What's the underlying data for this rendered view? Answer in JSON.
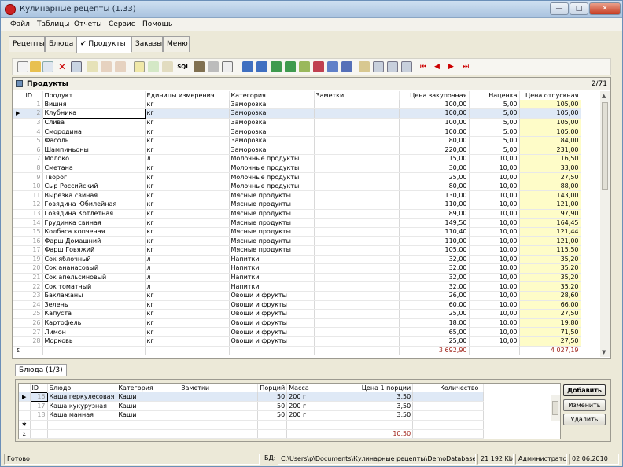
{
  "window": {
    "title": "Кулинарные рецепты (1.33)",
    "min": "—",
    "max": "□",
    "close": "✕"
  },
  "menu": [
    "Файл",
    "Таблицы",
    "Отчеты",
    "Сервис",
    "Помощь"
  ],
  "tabs": [
    {
      "label": "Рецепты"
    },
    {
      "label": "Блюда"
    },
    {
      "label": "✔ Продукты"
    },
    {
      "label": "Заказы"
    },
    {
      "label": "Меню"
    }
  ],
  "toolbar": {
    "sql_label": "SQL"
  },
  "products": {
    "title": "Продукты",
    "count": "2/71",
    "columns": [
      "ID",
      "Продукт",
      "Единицы измерения",
      "Категория",
      "Заметки",
      "Цена закупочная",
      "Наценка",
      "Цена отпускная"
    ],
    "rows": [
      [
        "1",
        "Вишня",
        "кг",
        "Заморозка",
        "",
        "100,00",
        "5,00",
        "105,00"
      ],
      [
        "2",
        "Клубника",
        "кг",
        "Заморозка",
        "",
        "100,00",
        "5,00",
        "105,00"
      ],
      [
        "3",
        "Слива",
        "кг",
        "Заморозка",
        "",
        "100,00",
        "5,00",
        "105,00"
      ],
      [
        "4",
        "Смородина",
        "кг",
        "Заморозка",
        "",
        "100,00",
        "5,00",
        "105,00"
      ],
      [
        "5",
        "Фасоль",
        "кг",
        "Заморозка",
        "",
        "80,00",
        "5,00",
        "84,00"
      ],
      [
        "6",
        "Шампиньоны",
        "кг",
        "Заморозка",
        "",
        "220,00",
        "5,00",
        "231,00"
      ],
      [
        "7",
        "Молоко",
        "л",
        "Молочные продукты",
        "",
        "15,00",
        "10,00",
        "16,50"
      ],
      [
        "8",
        "Сметана",
        "кг",
        "Молочные продукты",
        "",
        "30,00",
        "10,00",
        "33,00"
      ],
      [
        "9",
        "Творог",
        "кг",
        "Молочные продукты",
        "",
        "25,00",
        "10,00",
        "27,50"
      ],
      [
        "10",
        "Сыр Российский",
        "кг",
        "Молочные продукты",
        "",
        "80,00",
        "10,00",
        "88,00"
      ],
      [
        "11",
        "Вырезка свиная",
        "кг",
        "Мясные продукты",
        "",
        "130,00",
        "10,00",
        "143,00"
      ],
      [
        "12",
        "Говядина Юбилейная",
        "кг",
        "Мясные продукты",
        "",
        "110,00",
        "10,00",
        "121,00"
      ],
      [
        "13",
        "Говядина Котлетная",
        "кг",
        "Мясные продукты",
        "",
        "89,00",
        "10,00",
        "97,90"
      ],
      [
        "14",
        "Грудинка свиная",
        "кг",
        "Мясные продукты",
        "",
        "149,50",
        "10,00",
        "164,45"
      ],
      [
        "15",
        "Колбаса копченая",
        "кг",
        "Мясные продукты",
        "",
        "110,40",
        "10,00",
        "121,44"
      ],
      [
        "16",
        "Фарш Домашний",
        "кг",
        "Мясные продукты",
        "",
        "110,00",
        "10,00",
        "121,00"
      ],
      [
        "17",
        "Фарш Говяжий",
        "кг",
        "Мясные продукты",
        "",
        "105,00",
        "10,00",
        "115,50"
      ],
      [
        "19",
        "Сок яблочный",
        "л",
        "Напитки",
        "",
        "32,00",
        "10,00",
        "35,20"
      ],
      [
        "20",
        "Сок ананасовый",
        "л",
        "Напитки",
        "",
        "32,00",
        "10,00",
        "35,20"
      ],
      [
        "21",
        "Сок апельсиновый",
        "л",
        "Напитки",
        "",
        "32,00",
        "10,00",
        "35,20"
      ],
      [
        "22",
        "Сок томатный",
        "л",
        "Напитки",
        "",
        "32,00",
        "10,00",
        "35,20"
      ],
      [
        "23",
        "Баклажаны",
        "кг",
        "Овощи и фрукты",
        "",
        "26,00",
        "10,00",
        "28,60"
      ],
      [
        "24",
        "Зелень",
        "кг",
        "Овощи и фрукты",
        "",
        "60,00",
        "10,00",
        "66,00"
      ],
      [
        "25",
        "Капуста",
        "кг",
        "Овощи и фрукты",
        "",
        "25,00",
        "10,00",
        "27,50"
      ],
      [
        "26",
        "Картофель",
        "кг",
        "Овощи и фрукты",
        "",
        "18,00",
        "10,00",
        "19,80"
      ],
      [
        "27",
        "Лимон",
        "кг",
        "Овощи и фрукты",
        "",
        "65,00",
        "10,00",
        "71,50"
      ],
      [
        "28",
        "Морковь",
        "кг",
        "Овощи и фрукты",
        "",
        "25,00",
        "10,00",
        "27,50"
      ]
    ],
    "selected_row": 1,
    "sum_symbol": "Σ",
    "sum_purchase": "3 692,90",
    "sum_sale": "4 027,19"
  },
  "dishes": {
    "tab_label": "Блюда (1/3)",
    "columns": [
      "ID",
      "Блюдо",
      "Категория",
      "Заметки",
      "Порций",
      "Масса",
      "Цена 1 порции",
      "Количество"
    ],
    "rows": [
      [
        "16",
        "Каша геркулесовая",
        "Каши",
        "",
        "50",
        "200 г",
        "3,50",
        ""
      ],
      [
        "17",
        "Каша кукурузная",
        "Каши",
        "",
        "50",
        "200 г",
        "3,50",
        ""
      ],
      [
        "18",
        "Каша манная",
        "Каши",
        "",
        "50",
        "200 г",
        "3,50",
        ""
      ]
    ],
    "new_row_symbol": "✱",
    "sum_symbol": "Σ",
    "sum_price": "10,50",
    "buttons": {
      "add": "Добавить",
      "edit": "Изменить",
      "delete": "Удалить"
    }
  },
  "status": {
    "ready": "Готово",
    "db_label": "БД:",
    "db_path": "C:\\Users\\p\\Documents\\Кулинарные рецепты\\DemoDatabase.mdb",
    "size": "21 192 Kb",
    "user": "Администратор",
    "date": "02.06.2010"
  }
}
